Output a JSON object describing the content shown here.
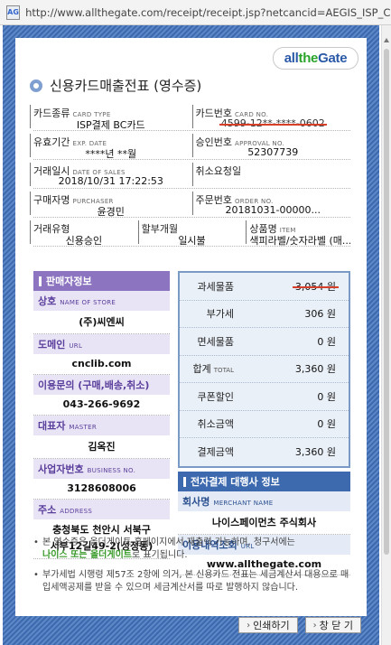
{
  "browser": {
    "favicon_text": "AG",
    "url": "http://www.allthegate.com/receipt/receipt.jsp?netcancid=AEGIS_ISP_CG_cn"
  },
  "logo": {
    "part1": "all",
    "part2": "the",
    "part3": "Gate"
  },
  "title": "신용카드매출전표 (영수증)",
  "fields": {
    "card_type": {
      "label": "카드종류",
      "sub": "CARD TYPE",
      "value": "ISP결제 BC카드"
    },
    "card_no": {
      "label": "카드번호",
      "sub": "CARD NO.",
      "value": "4599-12**-****-0602"
    },
    "exp_date": {
      "label": "유효기간",
      "sub": "EXP. DATE",
      "value": "****년 **월"
    },
    "approval_no": {
      "label": "승인번호",
      "sub": "APPROVAL NO.",
      "value": "52307739"
    },
    "date_of_sales": {
      "label": "거래일시",
      "sub": "DATE OF SALES",
      "value": "2018/10/31 17:22:53"
    },
    "cancel_request": {
      "label": "취소요청일",
      "sub": "",
      "value": ""
    },
    "purchaser": {
      "label": "구매자명",
      "sub": "PURCHASER",
      "value": "윤경민"
    },
    "order_no": {
      "label": "주문번호",
      "sub": "ORDER NO.",
      "value": "20181031-00000..."
    },
    "trade_type": {
      "label": "거래유형",
      "sub": "",
      "value": "신용승인"
    },
    "installment": {
      "label": "할부개월",
      "sub": "",
      "value": "일시불"
    },
    "item": {
      "label": "상품명",
      "sub": "ITEM",
      "value": "색피라벨/숫자라벨 (매..."
    }
  },
  "seller": {
    "header": "판매자정보",
    "store": {
      "label": "상호",
      "sub": "NAME OF STORE",
      "value": "(주)씨엔씨"
    },
    "domain": {
      "label": "도메인",
      "sub": "URL",
      "value": "cnclib.com"
    },
    "inquiry": {
      "label": "이용문의 (구매,배송,취소)",
      "sub": "",
      "value": "043-266-9692"
    },
    "master": {
      "label": "대표자",
      "sub": "MASTER",
      "value": "김옥진"
    },
    "business_no": {
      "label": "사업자번호",
      "sub": "BUSINESS NO.",
      "value": "3128608006"
    },
    "address": {
      "label": "주소",
      "sub": "ADDRESS",
      "line1": "충청북도 천안시 서북구",
      "line2": "서부12길49-2(성정동)"
    }
  },
  "amounts": [
    {
      "label": "과세물품",
      "sub": "",
      "value": "3,054 원",
      "strike": true
    },
    {
      "label": "부가세",
      "sub": "",
      "value": "306 원",
      "strike": false
    },
    {
      "label": "면세물품",
      "sub": "",
      "value": "0 원",
      "strike": false
    },
    {
      "label": "합계",
      "sub": "TOTAL",
      "value": "3,360 원",
      "strike": false
    },
    {
      "label": "쿠폰할인",
      "sub": "",
      "value": "0 원",
      "strike": false
    },
    {
      "label": "취소금액",
      "sub": "",
      "value": "0 원",
      "strike": false
    },
    {
      "label": "결제금액",
      "sub": "",
      "value": "3,360 원",
      "strike": false
    }
  ],
  "agent": {
    "header": "전자결제 대행사 정보",
    "merchant": {
      "label": "회사명",
      "sub": "MERCHANT NAME",
      "value": "나이스페이먼츠 주식회사"
    },
    "url": {
      "label": "이용내역조회",
      "sub": "URL",
      "value": "www.allthegate.com"
    }
  },
  "notes": {
    "n1_a": "본 영수증은 올더게이트 홈페이지에서 재출력 가능하며, 청구서에는",
    "n1_b": "나이스 또는 올더게이트",
    "n1_c": "로 표기됩니다.",
    "n2": "부가세법 시행령 제57조 2항에 의거, 본 신용카드 전표는 세금계산서 대용으로 매입세액공제를 받을 수 있으며 세금계산서를 따로 발행하지 않습니다."
  },
  "buttons": {
    "print": "인쇄하기",
    "close": "창 닫 기"
  }
}
